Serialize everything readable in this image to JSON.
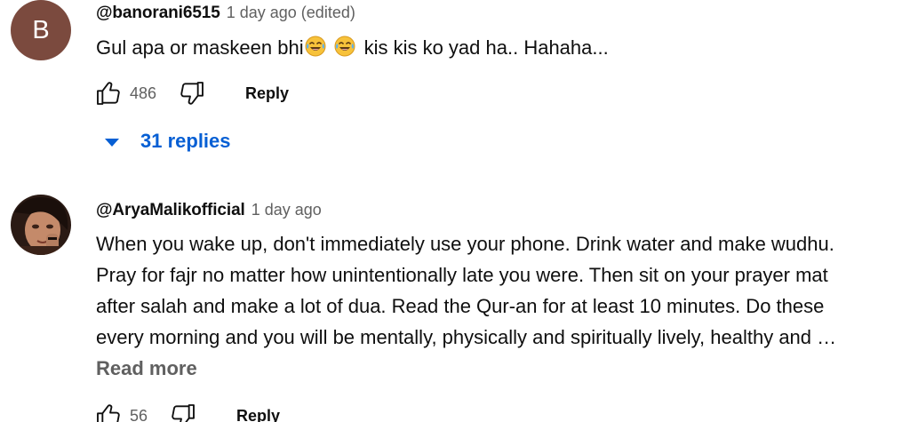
{
  "comments": [
    {
      "avatar_letter": "B",
      "avatar_color": "#7b4a3e",
      "author": "@banorani6515",
      "timestamp": "1 day ago (edited)",
      "text_before": "Gul apa or maskeen bhi",
      "emojis": [
        "face-with-tears-of-joy-icon",
        "face-with-tears-of-joy-icon"
      ],
      "text_after": "kis kis ko yad ha.. Hahaha...",
      "likes": "486",
      "reply_label": "Reply",
      "replies_label": "31 replies"
    },
    {
      "author": "@AryaMalikofficial",
      "timestamp": "1 day ago",
      "lines": [
        "When you wake up, don't immediately use your phone. Drink water and make wudhu.",
        "Pray for fajr no matter how unintentionally late you were. Then sit on your prayer mat",
        "after salah and make a lot of dua. Read the Qur-an for at least 10 minutes. Do these",
        "every morning and you will be mentally, physically and spiritually lively, healthy and …"
      ],
      "read_more_label": "Read more",
      "likes": "56",
      "reply_label": "Reply"
    }
  ],
  "colors": {
    "link_blue": "#065fd4",
    "muted_text": "#606060",
    "primary_text": "#0f0f0f"
  }
}
